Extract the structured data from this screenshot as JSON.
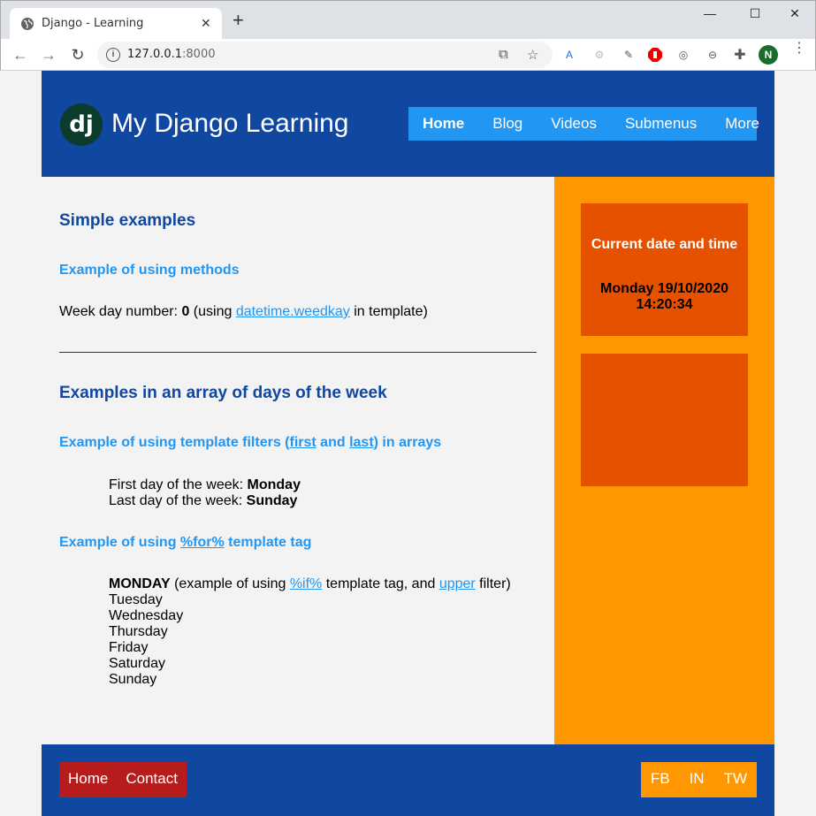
{
  "browser": {
    "tab_title": "Django - Learning",
    "new_tab": "+",
    "url_host": "127.0.0.1",
    "url_port": ":8000",
    "avatar_letter": "N"
  },
  "site": {
    "logo_text": "dj",
    "title": "My Django Learning",
    "menu": [
      "Home",
      "Blog",
      "Videos",
      "Submenus",
      "More"
    ],
    "active_menu": "Home"
  },
  "content": {
    "h_simple": "Simple examples",
    "h_methods": "Example of using methods",
    "weekday_prefix": "Week day number: ",
    "weekday_value": "0",
    "weekday_mid": " (using ",
    "weekday_link": "datetime.weedkay",
    "weekday_suffix": " in template)",
    "h_array": "Examples in an array of days of the week",
    "h_filters_a": "Example of using template filters (",
    "h_filters_first": "first",
    "h_filters_and": " and ",
    "h_filters_last": "last",
    "h_filters_b": ") in arrays",
    "first_day_label": "First day of the week: ",
    "first_day_value": "Monday",
    "last_day_label": "Last day of the week: ",
    "last_day_value": "Sunday",
    "h_for_a": "Example of using ",
    "h_for_link": "%for%",
    "h_for_b": " template tag",
    "day_upper": "MONDAY",
    "day_upper_a": " (example of using ",
    "day_upper_if": "%if%",
    "day_upper_b": " template tag, and ",
    "day_upper_filter": "upper",
    "day_upper_c": " filter)",
    "days": [
      "Tuesday",
      "Wednesday",
      "Thursday",
      "Friday",
      "Saturday",
      "Sunday"
    ]
  },
  "sidebar": {
    "box_title": "Current date and time",
    "date_line1": "Monday 19/10/2020",
    "date_line2": "14:20:34"
  },
  "footer": {
    "left": [
      "Home",
      "Contact"
    ],
    "right": [
      "FB",
      "IN",
      "TW"
    ]
  },
  "colors": {
    "header_blue": "#0f47a1",
    "menu_blue": "#2196f3",
    "sidebar_orange": "#ff9800",
    "box_orange": "#e65100",
    "footer_red": "#b71c1c"
  }
}
